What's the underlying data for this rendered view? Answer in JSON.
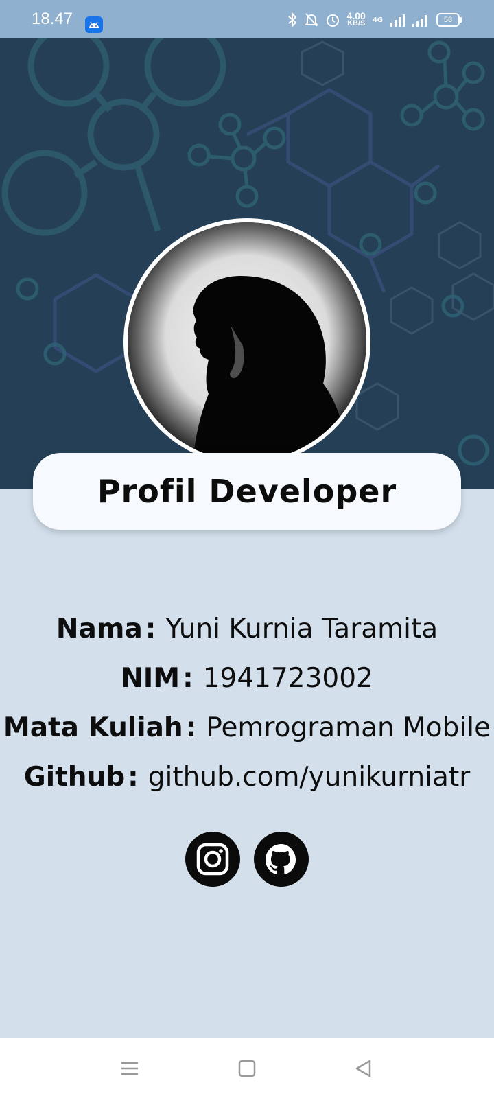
{
  "status_bar": {
    "time": "18.47",
    "speed_value": "4.00",
    "speed_unit": "KB/S",
    "network_type": "4G",
    "battery": "58",
    "icons": [
      "android-icon",
      "bluetooth-icon",
      "bell-off-icon",
      "alarm-icon",
      "signal-icon",
      "battery-icon"
    ]
  },
  "title_card": {
    "title": "Profil Developer"
  },
  "profile": {
    "rows": [
      {
        "label": "Nama",
        "separator": ":",
        "value": "Yuni Kurnia Taramita"
      },
      {
        "label": "NIM",
        "separator": ":",
        "value": "1941723002"
      },
      {
        "label": "Mata Kuliah",
        "separator": ":",
        "value": "Pemrograman Mobile"
      },
      {
        "label": "Github",
        "separator": ":",
        "value": "github.com/yunikurniatr"
      }
    ]
  },
  "social": {
    "icons": [
      "instagram-icon",
      "github-icon"
    ]
  },
  "nav_bar": {
    "icons": [
      "menu-icon",
      "home-icon",
      "back-icon"
    ]
  },
  "colors": {
    "status_bar": "#8fb1cf",
    "banner": "#253f56",
    "page_background": "#d3e0ec",
    "title_card": "#f6f9fd",
    "social_icon": "#0b0b0b"
  }
}
